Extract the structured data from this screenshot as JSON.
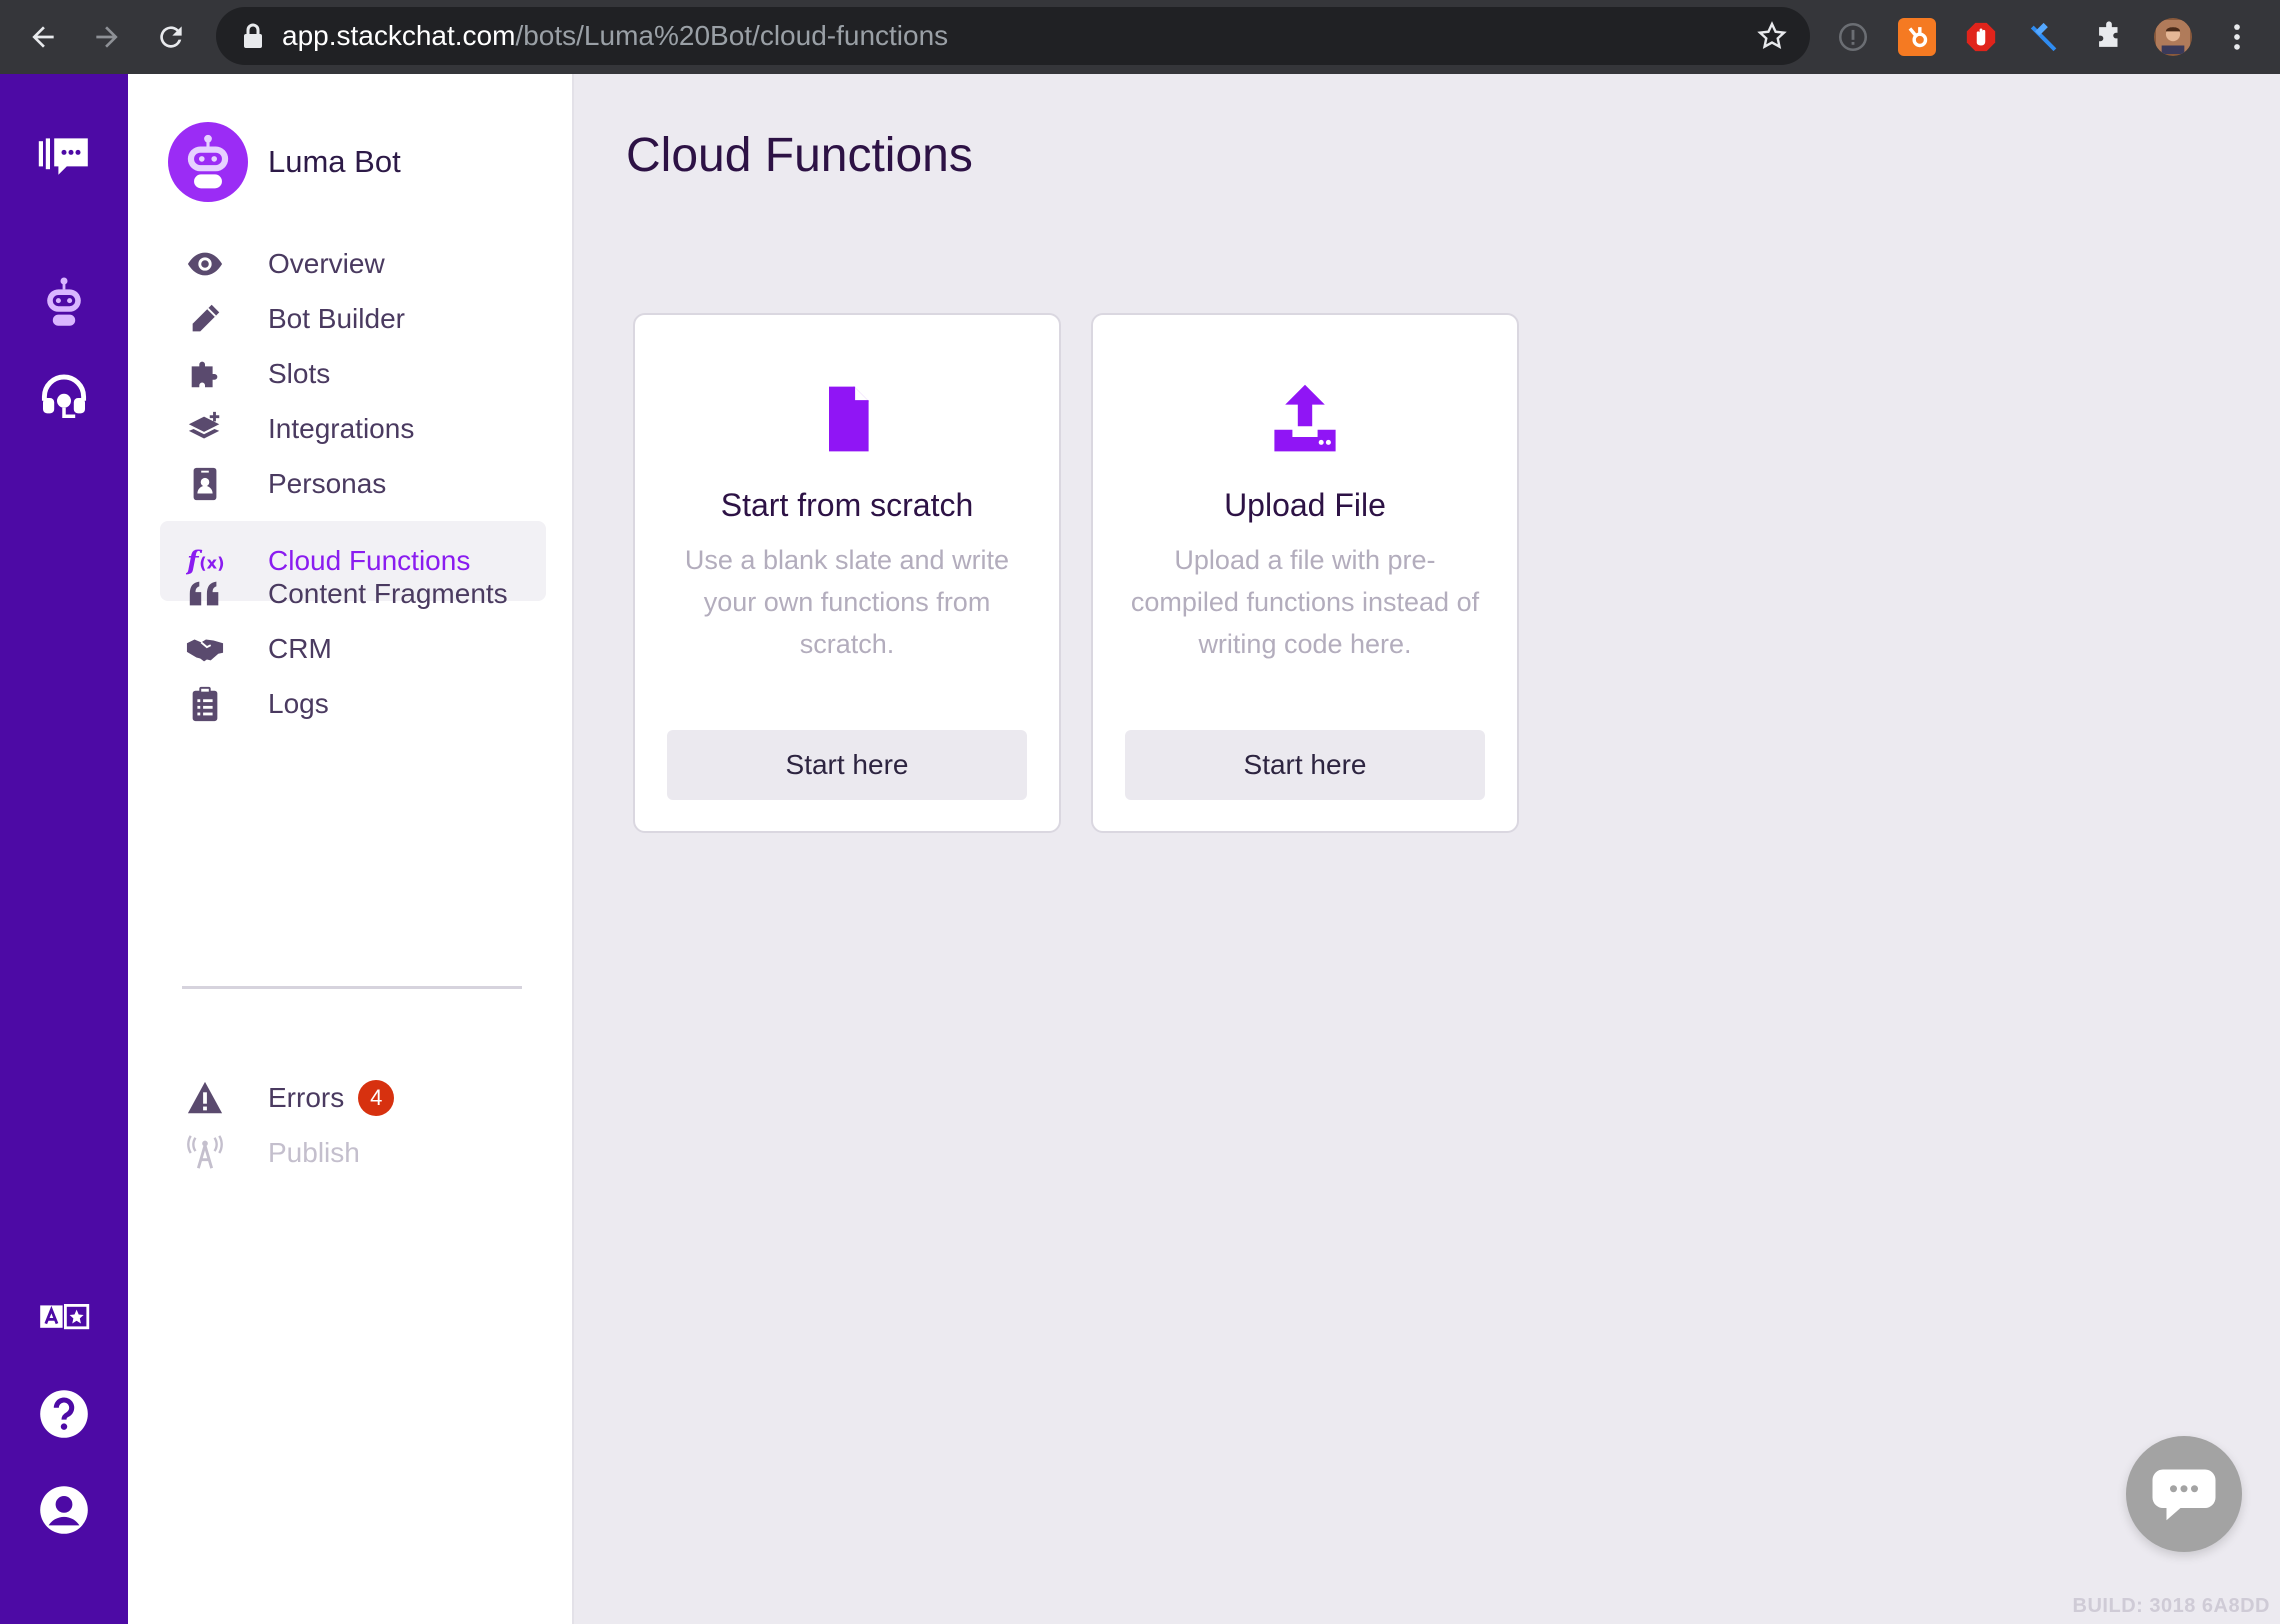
{
  "browser": {
    "url_host": "app.stackchat.com",
    "url_path": "/bots/Luma%20Bot/cloud-functions",
    "extensions": [
      "info-icon",
      "hubspot-icon",
      "adblock-icon",
      "dev-tool-icon",
      "extensions-puzzle-icon",
      "profile-avatar"
    ]
  },
  "rail": {
    "top_icons": [
      "stackchat-logo-icon",
      "bot-icon",
      "support-headset-icon"
    ],
    "bottom_icons": [
      "translate-icon",
      "help-icon",
      "account-icon"
    ]
  },
  "sidebar": {
    "bot_name": "Luma Bot",
    "items": [
      {
        "label": "Overview",
        "icon": "eye-icon"
      },
      {
        "label": "Bot Builder",
        "icon": "pencil-icon"
      },
      {
        "label": "Slots",
        "icon": "puzzle-icon"
      },
      {
        "label": "Integrations",
        "icon": "layers-plus-icon"
      },
      {
        "label": "Personas",
        "icon": "id-badge-icon"
      },
      {
        "label": "Cloud Functions",
        "icon": "function-icon",
        "active": true
      },
      {
        "label": "Content Fragments",
        "icon": "quote-icon"
      },
      {
        "label": "CRM",
        "icon": "handshake-icon"
      },
      {
        "label": "Logs",
        "icon": "clipboard-icon"
      }
    ],
    "secondary": [
      {
        "label": "Errors",
        "icon": "warning-icon",
        "badge": "4"
      },
      {
        "label": "Publish",
        "icon": "broadcast-icon",
        "disabled": true
      }
    ]
  },
  "main": {
    "title": "Cloud Functions",
    "cards": [
      {
        "title": "Start from scratch",
        "description": "Use a blank slate and write your own functions from scratch.",
        "button": "Start here",
        "icon": "file-icon"
      },
      {
        "title": "Upload File",
        "description": "Upload a file with pre-compiled functions instead of writing code here.",
        "button": "Start here",
        "icon": "upload-icon"
      }
    ]
  },
  "footer": {
    "build": "BUILD: 3018 6A8DD"
  },
  "colors": {
    "rail": "#4d0aa5",
    "accent": "#8a1cf0",
    "badge": "#d7310f",
    "background": "#eceaf0"
  }
}
